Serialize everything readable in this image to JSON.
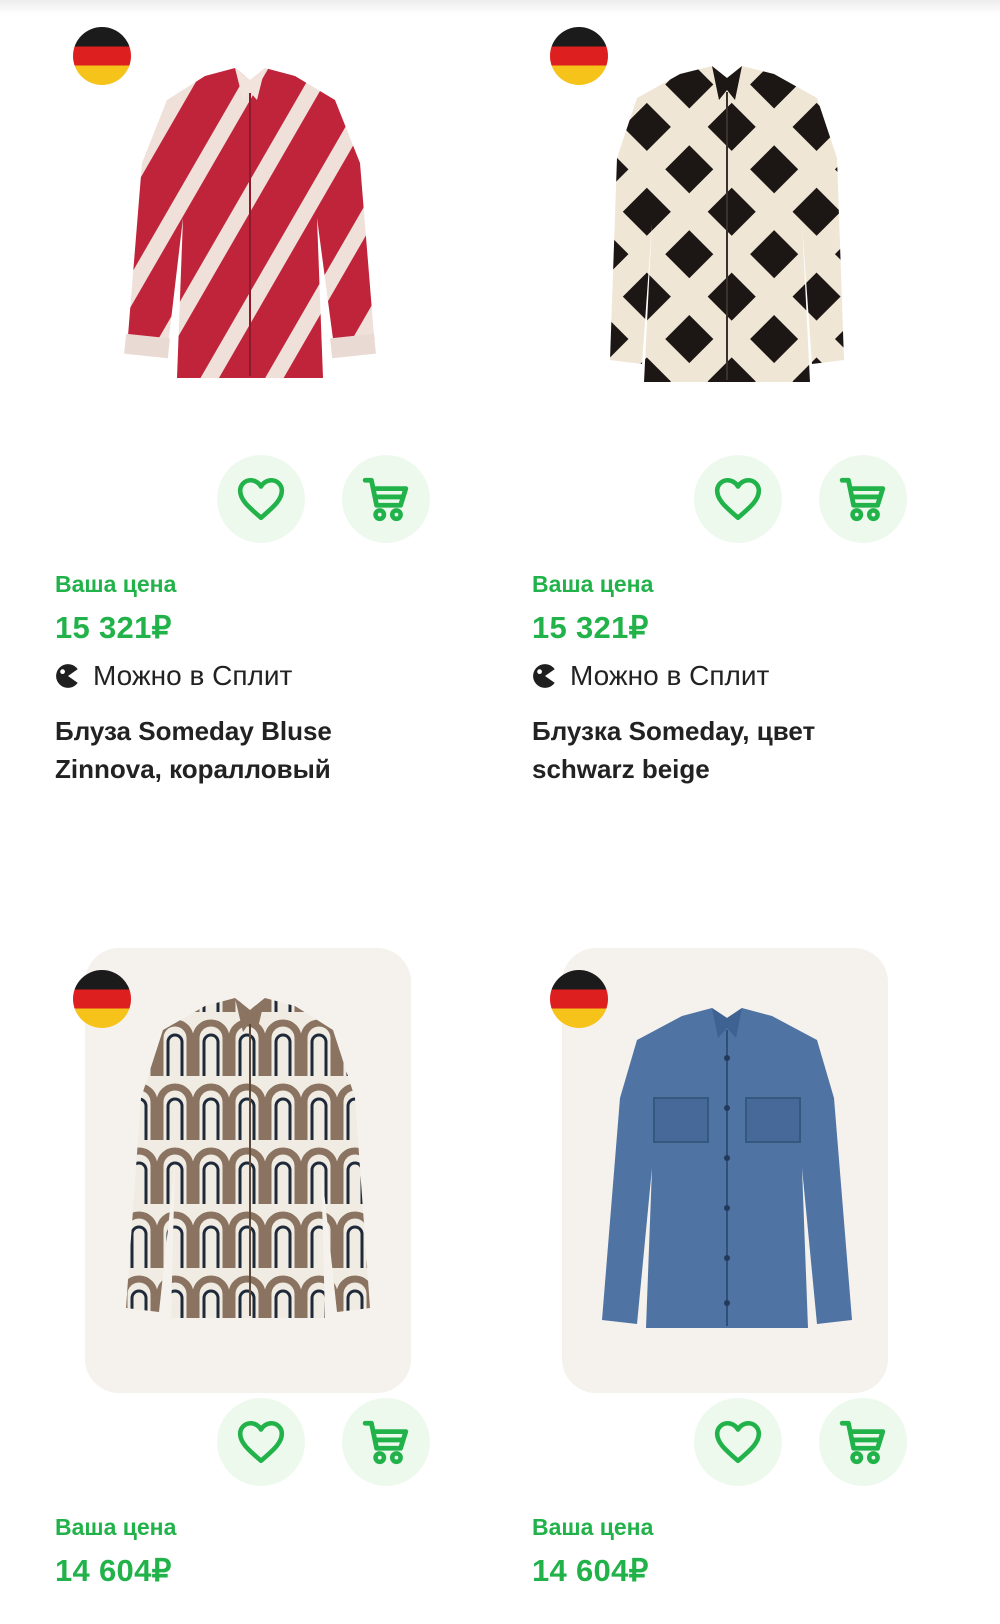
{
  "colors": {
    "accent_green": "#21b24a",
    "button_bg": "#eef9ee",
    "text_dark": "#222222",
    "image_bg_beige": "#f5f1ec"
  },
  "icons": {
    "flag": "germany-flag-icon",
    "favorite": "heart-icon",
    "cart": "cart-icon",
    "split": "split-icon"
  },
  "products": [
    {
      "price_label": "Ваша цена",
      "price": "15 321₽",
      "installment": "Можно в Сплит",
      "title_line1": "Блуза Someday Bluse",
      "title_line2": "Zinnova, коралловый"
    },
    {
      "price_label": "Ваша цена",
      "price": "15 321₽",
      "installment": "Можно в Сплит",
      "title_line1": "Блузка Someday, цвет",
      "title_line2": "schwarz beige"
    },
    {
      "price_label": "Ваша цена",
      "price": "14 604₽"
    },
    {
      "price_label": "Ваша цена",
      "price": "14 604₽"
    }
  ]
}
